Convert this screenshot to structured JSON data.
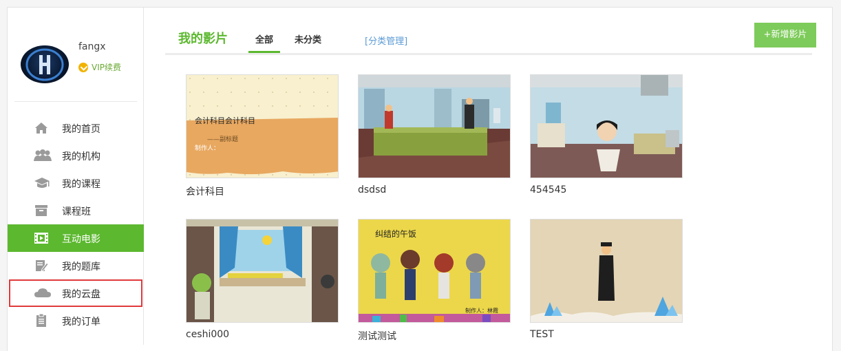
{
  "user": {
    "name": "fangx",
    "vip_label": "VIP续费"
  },
  "nav": [
    {
      "label": "我的首页",
      "icon": "home-icon"
    },
    {
      "label": "我的机构",
      "icon": "group-icon"
    },
    {
      "label": "我的课程",
      "icon": "graduation-cap-icon"
    },
    {
      "label": "课程班",
      "icon": "box-icon"
    },
    {
      "label": "互动电影",
      "icon": "film-icon"
    },
    {
      "label": "我的题库",
      "icon": "edit-icon"
    },
    {
      "label": "我的云盘",
      "icon": "cloud-icon"
    },
    {
      "label": "我的订单",
      "icon": "clipboard-icon"
    }
  ],
  "header": {
    "title": "我的影片",
    "tabs": [
      "全部",
      "未分类"
    ],
    "category_link": "[分类管理]",
    "add_button": "+新增影片"
  },
  "movies": [
    {
      "title": "会计科目",
      "thumb_line1": "会计科目会计科目",
      "thumb_line2": "——副标题",
      "thumb_line3": "制作人："
    },
    {
      "title": "dsdsd"
    },
    {
      "title": "454545"
    },
    {
      "title": "ceshi000"
    },
    {
      "title": "测试测试",
      "thumb_heading": "纠结的午饭",
      "thumb_credit": "制作人：林霞"
    },
    {
      "title": "TEST"
    }
  ],
  "colors": {
    "accent": "#5cb82f",
    "link": "#5b9bd5",
    "highlight_border": "#e0393b"
  }
}
